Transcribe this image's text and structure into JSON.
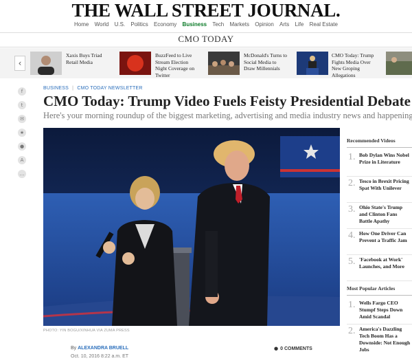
{
  "masthead": {
    "logo": "THE WALL STREET JOURNAL."
  },
  "nav": {
    "items": [
      "Home",
      "World",
      "U.S.",
      "Politics",
      "Economy",
      "Business",
      "Tech",
      "Markets",
      "Opinion",
      "Arts",
      "Life",
      "Real Estate"
    ],
    "active": "Business"
  },
  "section": {
    "title": "CMO TODAY"
  },
  "carousel": {
    "items": [
      {
        "text": "Xaxis Buys Triad Retail Media",
        "thumb_icon": "person-portrait"
      },
      {
        "text": "BuzzFeed to Live Stream Election Night Coverage on Twitter",
        "thumb_icon": "buzzfeed-logo",
        "thumb_label": "BuzzFeed"
      },
      {
        "text": "McDonald's Turns to Social Media to Draw Millennials",
        "thumb_icon": "restaurant-crowd"
      },
      {
        "text": "CMO Today: Trump Fights Media Over New Groping Allegations",
        "thumb_icon": "podium-speaker"
      },
      {
        "text": "",
        "thumb_icon": "cut-off-thumbnail"
      }
    ]
  },
  "share": {
    "icons": [
      "facebook-icon",
      "twitter-icon",
      "email-icon",
      "bookmark-icon",
      "comment-icon",
      "font-size-icon",
      "more-icon"
    ]
  },
  "article": {
    "kicker_section": "BUSINESS",
    "kicker_sep": "|",
    "kicker_sub": "CMO TODAY NEWSLETTER",
    "headline": "CMO Today: Trump Video Fuels Feisty Presidential Debate",
    "dek": "Here's your morning roundup of the biggest marketing, advertising and media industry news and happenings.",
    "photo_caption": "PHOTO: YIN BOGU/XINHUA VIA ZUMA PRESS",
    "byline_prefix": "By",
    "author": "ALEXANDRA BRUELL",
    "date": "Oct. 10, 2016 8:22 a.m. ET",
    "comments": "0 COMMENTS"
  },
  "rail": {
    "videos_title": "Recommended Videos",
    "videos": [
      {
        "num": "1.",
        "title": "Bob Dylan Wins Nobel Prize in Literature"
      },
      {
        "num": "2.",
        "title": "Tesco in Brexit Pricing Spat With Unilever"
      },
      {
        "num": "3.",
        "title": "Ohio State's Trump and Clinton Fans Battle Apathy"
      },
      {
        "num": "4.",
        "title": "How One Driver Can Prevent a Traffic Jam"
      },
      {
        "num": "5.",
        "title": "'Facebook at Work' Launches, and More"
      }
    ],
    "popular_title": "Most Popular Articles",
    "popular": [
      {
        "num": "1.",
        "title": "Wells Fargo CEO Stumpf Steps Down Amid Scandal"
      },
      {
        "num": "2.",
        "title": "America's Dazzling Tech Boom Has a Downside: Not Enough Jobs"
      }
    ]
  },
  "colors": {
    "accent_green": "#0a7a27",
    "link_blue": "#2a6ebb",
    "stage_blue": "#1f3a6e"
  }
}
